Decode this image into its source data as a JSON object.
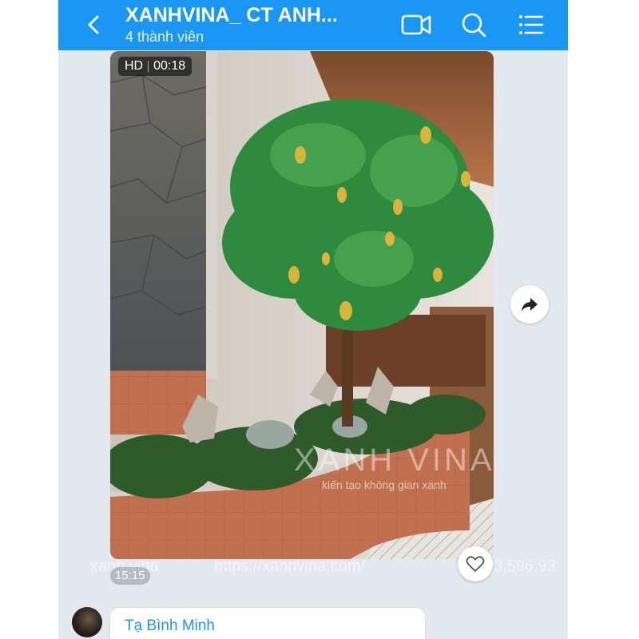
{
  "header": {
    "title": "XANHVINA_ CT ANH...",
    "subtitle": "4 thành viên",
    "back_icon": "chevron-left-icon",
    "video_call_icon": "video-camera-icon",
    "search_icon": "search-icon",
    "menu_icon": "list-menu-icon",
    "background": "#1a97f5"
  },
  "message": {
    "video": {
      "quality": "HD",
      "duration": "00:18",
      "watermark_title": "XANH VINA",
      "watermark_tagline": "kiến tạo không gian xanh"
    },
    "time": "15:15",
    "overlay_left": "xanh vina",
    "overlay_url": "https://xanhvina.com/",
    "overlay_phone": "3.596.93",
    "share_icon": "share-arrow-icon",
    "reaction_icon": "heart-icon"
  },
  "next_message": {
    "sender": "Tạ Bình Minh",
    "avatar_icon": "avatar"
  },
  "colors": {
    "accent": "#1a97f5",
    "chat_background": "#e3e8ee"
  }
}
